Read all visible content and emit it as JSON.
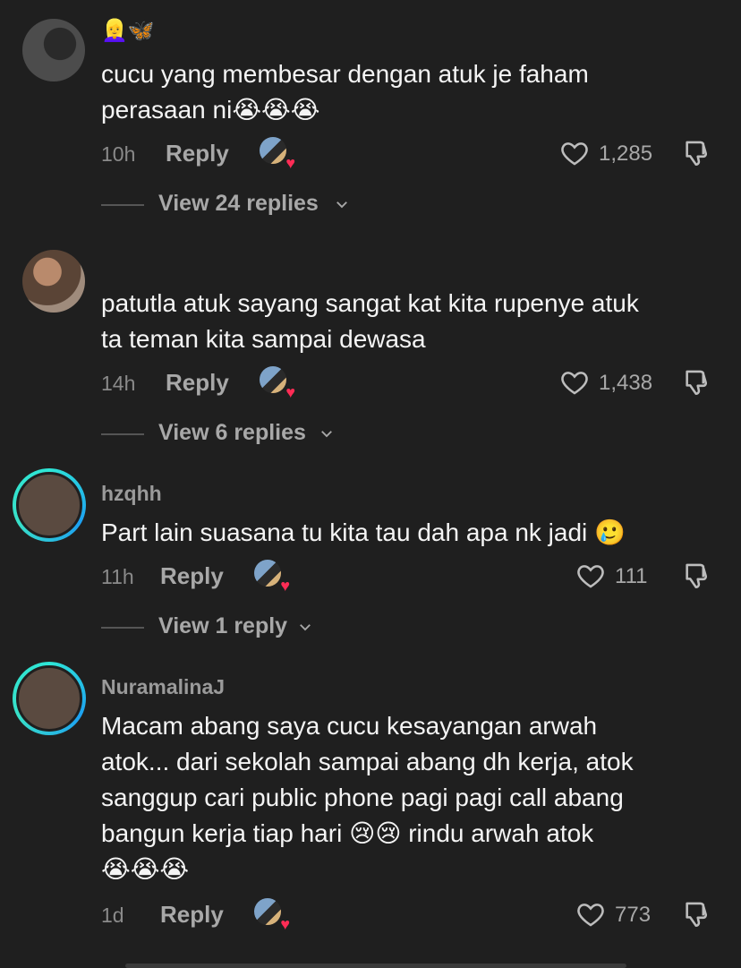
{
  "comments": [
    {
      "username": "",
      "name_emojis": "👱‍♀️🦋",
      "text_lines": [
        "cucu yang membesar dengan atuk je faham",
        "perasaan ni😭😭😭"
      ],
      "time": "10h",
      "reply_label": "Reply",
      "likes": "1,285",
      "view_replies": "View 24 replies"
    },
    {
      "username": "",
      "text_lines": [
        "patutla atuk sayang sangat kat kita rupenye atuk",
        "ta teman kita sampai dewasa"
      ],
      "time": "14h",
      "reply_label": "Reply",
      "likes": "1,438",
      "view_replies": "View 6 replies"
    },
    {
      "username": "hzqhh",
      "text_lines": [
        "Part lain suasana tu kita tau dah apa nk jadi 🥲"
      ],
      "time": "11h",
      "reply_label": "Reply",
      "likes": "111",
      "view_replies": "View 1 reply"
    },
    {
      "username": "NuramalinaJ",
      "text_lines": [
        "Macam abang saya cucu kesayangan arwah",
        "atok... dari sekolah sampai abang dh kerja, atok",
        "sanggup cari public phone pagi pagi call abang",
        "bangun kerja tiap hari 😢😢 rindu arwah atok",
        "😭😭😭"
      ],
      "time": "1d",
      "reply_label": "Reply",
      "likes": "773"
    }
  ],
  "colors": {
    "background": "#1f1f1f",
    "text": "#f4f4f4",
    "muted": "#a8a8a8",
    "accent_heart": "#fe2c55",
    "story_ring": "#2ee6d6"
  },
  "icons": {
    "like": "heart-outline-icon",
    "dislike": "thumbs-down-outline-icon",
    "creator_liked": "creator-liked-heart-icon",
    "expand": "chevron-down-icon"
  }
}
